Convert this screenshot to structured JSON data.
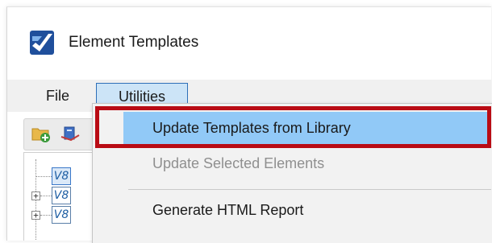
{
  "window": {
    "title": "Element Templates",
    "app_icon": "microstation-logo-icon"
  },
  "menubar": {
    "items": [
      {
        "label": "File"
      },
      {
        "label": "Utilities",
        "state": "open"
      }
    ]
  },
  "toolbar": {
    "icons": [
      "open-folder-add-icon",
      "library-icon"
    ]
  },
  "tree": {
    "nodes": [
      {
        "label": "V8",
        "selected": true
      },
      {
        "label": "V8",
        "expander": "+"
      },
      {
        "label": "V8",
        "expander": "+"
      }
    ]
  },
  "utilities_menu": {
    "items": [
      {
        "label": "Update Templates from Library",
        "highlighted": true,
        "enabled": true
      },
      {
        "label": "Update Selected Elements",
        "enabled": false
      },
      {
        "label": "Generate HTML Report",
        "enabled": true
      }
    ]
  },
  "colors": {
    "menu_highlight": "#91c9f7",
    "annotation_box": "#b90b14",
    "menubar_selected": "#cce4f7"
  }
}
